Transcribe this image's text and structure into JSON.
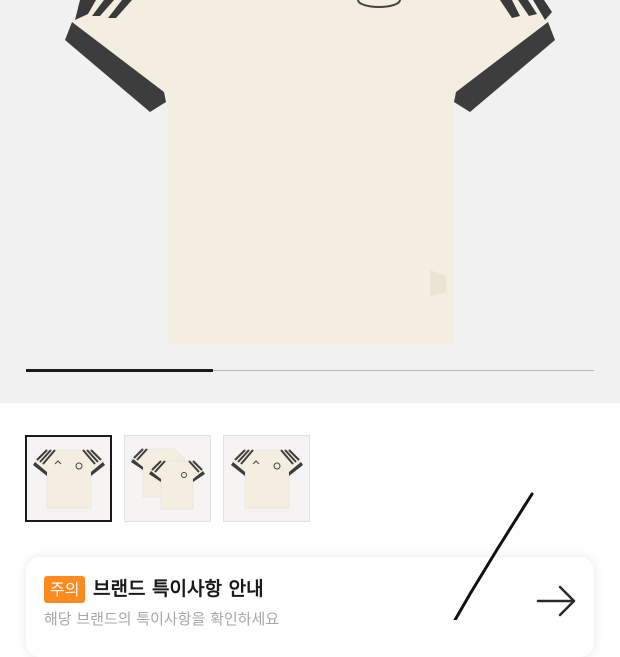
{
  "hero": {
    "image_name": "germany-jersey-tshirt-image",
    "slide_progress": 0.33
  },
  "thumbnails": [
    {
      "name": "thumbnail-1",
      "kind": "single-shirt",
      "selected": true
    },
    {
      "name": "thumbnail-2",
      "kind": "two-shirts",
      "selected": false
    },
    {
      "name": "thumbnail-3",
      "kind": "single-shirt",
      "selected": false
    }
  ],
  "notice": {
    "badge": "주의",
    "title": "브랜드 특이사항 안내",
    "subtitle": "해당 브랜드의 특이사항을 확인하세요",
    "arrow_icon": "arrow-right-icon",
    "badge_color": "#ff8a1f"
  }
}
